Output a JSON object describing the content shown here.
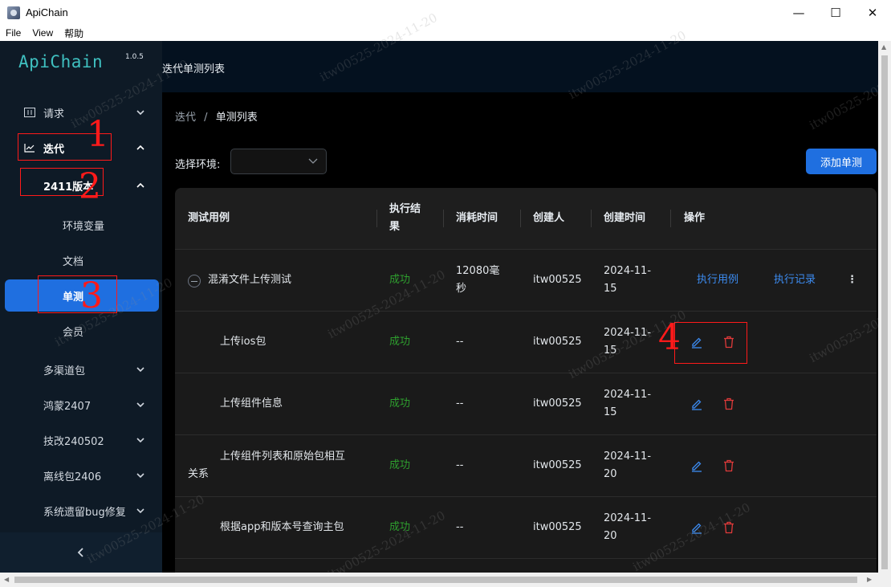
{
  "window": {
    "title": "ApiChain",
    "minimize_glyph": "—",
    "maximize_glyph": "☐",
    "close_glyph": "✕"
  },
  "menu": {
    "items": [
      "File",
      "View",
      "帮助"
    ]
  },
  "sidebar": {
    "logo": "ApiChain",
    "version": "1.0.5",
    "items": [
      {
        "label": "请求",
        "icon": "request-icon",
        "expandable": true
      },
      {
        "label": "迭代",
        "icon": "chart-icon",
        "expandable": true,
        "expanded": true
      },
      {
        "label": "2411版本",
        "expandable": true,
        "expanded": true
      },
      {
        "label": "环境变量"
      },
      {
        "label": "文档"
      },
      {
        "label": "单测",
        "active": true
      },
      {
        "label": "会员"
      },
      {
        "label": "多渠道包",
        "expandable": true
      },
      {
        "label": "鸿蒙2407",
        "expandable": true
      },
      {
        "label": "技改240502",
        "expandable": true
      },
      {
        "label": "离线包2406",
        "expandable": true
      },
      {
        "label": "系统遗留bug修复",
        "expandable": true
      }
    ],
    "collapse_glyph": "<"
  },
  "header": {
    "title": "迭代单测列表"
  },
  "breadcrumb": {
    "parent": "迭代",
    "separator": "/",
    "current": "单测列表"
  },
  "env": {
    "label": "选择环境:",
    "value": ""
  },
  "add_button": "添加单测",
  "table": {
    "columns": [
      "测试用例",
      "执行结",
      "果",
      "消耗时间",
      "创建人",
      "创建时间",
      "操作"
    ],
    "rows": [
      {
        "name": "混淆文件上传测试",
        "result": "成功",
        "duration_line1": "12080毫",
        "duration_line2": "秒",
        "creator": "itw00525",
        "date_line1": "2024-11-",
        "date_line2": "15",
        "action1": "执行用例",
        "action2": "执行记录",
        "more": "⋮"
      },
      {
        "name": "上传ios包",
        "result": "成功",
        "duration": "--",
        "creator": "itw00525",
        "date_line1": "2024-11-",
        "date_line2": "15"
      },
      {
        "name": "上传组件信息",
        "result": "成功",
        "duration": "--",
        "creator": "itw00525",
        "date_line1": "2024-11-",
        "date_line2": "15"
      },
      {
        "name_line1": "上传组件列表和原始包相互",
        "name_line2": "关系",
        "result": "成功",
        "duration": "--",
        "creator": "itw00525",
        "date_line1": "2024-11-",
        "date_line2": "20"
      },
      {
        "name": "根据app和版本号查询主包",
        "result": "成功",
        "duration": "--",
        "creator": "itw00525",
        "date_line1": "2024-11-",
        "date_line2": "20"
      }
    ]
  },
  "annotations": [
    "1",
    "2",
    "3",
    "4"
  ],
  "watermark": "itw00525-2024-11-20",
  "colors": {
    "accent": "#1f6fe0",
    "success": "#2e9e2e",
    "link": "#3c8cf2",
    "danger": "#e03a3a",
    "annotation": "#ff1a1a",
    "logo": "#3fc0c0"
  }
}
